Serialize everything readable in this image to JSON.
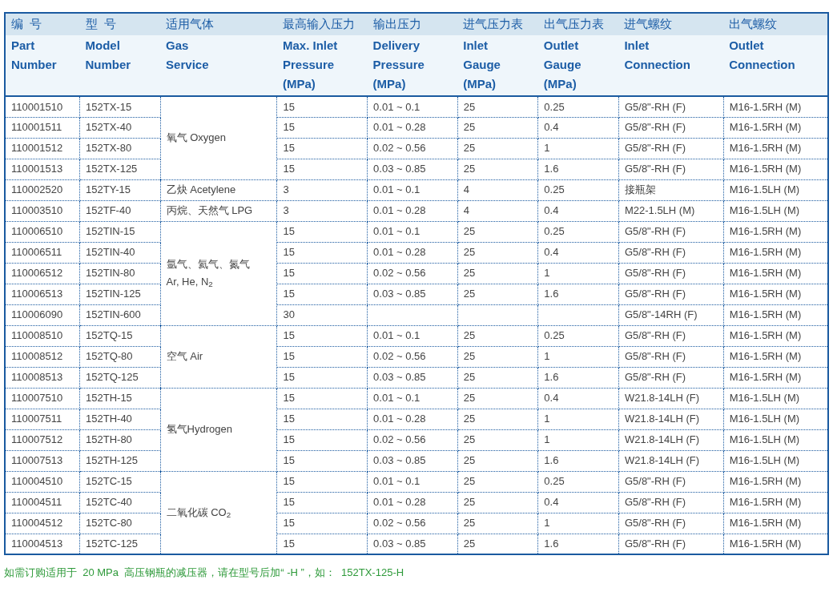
{
  "table": {
    "columns": [
      {
        "zh": "编  号",
        "en": [
          "Part",
          "Number"
        ]
      },
      {
        "zh": "型  号",
        "en": [
          "Model",
          "Number"
        ]
      },
      {
        "zh": "适用气体",
        "en": [
          "Gas",
          "Service"
        ]
      },
      {
        "zh": "最高输入压力",
        "en": [
          "Max. Inlet",
          "Pressure",
          "(MPa)"
        ]
      },
      {
        "zh": "输出压力",
        "en": [
          "Delivery",
          "Pressure",
          "(MPa)"
        ]
      },
      {
        "zh": "进气压力表",
        "en": [
          "Inlet",
          "Gauge",
          "(MPa)"
        ]
      },
      {
        "zh": "出气压力表",
        "en": [
          "Outlet",
          "Gauge",
          "(MPa)"
        ]
      },
      {
        "zh": "进气螺纹",
        "en": [
          "Inlet",
          "Connection"
        ]
      },
      {
        "zh": "出气螺纹",
        "en": [
          "Outlet",
          "Connection"
        ]
      }
    ],
    "groups": [
      {
        "gas": [
          "氧气 Oxygen"
        ],
        "rows": [
          [
            "110001510",
            "152TX-15",
            "15",
            "0.01 ~ 0.1",
            "25",
            "0.25",
            "G5/8\"-RH (F)",
            "M16-1.5RH (M)"
          ],
          [
            "110001511",
            "152TX-40",
            "15",
            "0.01 ~ 0.28",
            "25",
            "0.4",
            "G5/8\"-RH (F)",
            "M16-1.5RH (M)"
          ],
          [
            "110001512",
            "152TX-80",
            "15",
            "0.02 ~ 0.56",
            "25",
            "1",
            "G5/8\"-RH (F)",
            "M16-1.5RH (M)"
          ],
          [
            "110001513",
            "152TX-125",
            "15",
            "0.03 ~ 0.85",
            "25",
            "1.6",
            "G5/8\"-RH (F)",
            "M16-1.5RH (M)"
          ]
        ]
      },
      {
        "gas": [
          "乙炔 Acetylene"
        ],
        "rows": [
          [
            "110002520",
            "152TY-15",
            "3",
            "0.01 ~ 0.1",
            "4",
            "0.25",
            "接瓶架",
            "M16-1.5LH (M)"
          ]
        ]
      },
      {
        "gas": [
          "丙烷、天然气 LPG"
        ],
        "rows": [
          [
            "110003510",
            "152TF-40",
            "3",
            "0.01 ~ 0.28",
            "4",
            "0.4",
            "M22-1.5LH (M)",
            "M16-1.5LH (M)"
          ]
        ]
      },
      {
        "gas": [
          "氩气、氦气、氮气",
          "Ar, He, N$_{2}$"
        ],
        "rows": [
          [
            "110006510",
            "152TIN-15",
            "15",
            "0.01 ~ 0.1",
            "25",
            "0.25",
            "G5/8\"-RH (F)",
            "M16-1.5RH (M)"
          ],
          [
            "110006511",
            "152TIN-40",
            "15",
            "0.01 ~ 0.28",
            "25",
            "0.4",
            "G5/8\"-RH (F)",
            "M16-1.5RH (M)"
          ],
          [
            "110006512",
            "152TIN-80",
            "15",
            "0.02 ~ 0.56",
            "25",
            "1",
            "G5/8\"-RH (F)",
            "M16-1.5RH (M)"
          ],
          [
            "110006513",
            "152TIN-125",
            "15",
            "0.03 ~ 0.85",
            "25",
            "1.6",
            "G5/8\"-RH (F)",
            "M16-1.5RH (M)"
          ],
          [
            "110006090",
            "152TIN-600",
            "30",
            null,
            null,
            null,
            "G5/8\"-14RH (F)",
            "M16-1.5RH (M)"
          ]
        ]
      },
      {
        "gas": [
          "空气 Air"
        ],
        "rows": [
          [
            "110008510",
            "152TQ-15",
            "15",
            "0.01 ~ 0.1",
            "25",
            "0.25",
            "G5/8\"-RH (F)",
            "M16-1.5RH (M)"
          ],
          [
            "110008512",
            "152TQ-80",
            "15",
            "0.02 ~ 0.56",
            "25",
            "1",
            "G5/8\"-RH (F)",
            "M16-1.5RH (M)"
          ],
          [
            "110008513",
            "152TQ-125",
            "15",
            "0.03 ~ 0.85",
            "25",
            "1.6",
            "G5/8\"-RH (F)",
            "M16-1.5RH (M)"
          ]
        ]
      },
      {
        "gas": [
          "氢气Hydrogen"
        ],
        "rows": [
          [
            "110007510",
            "152TH-15",
            "15",
            "0.01 ~ 0.1",
            "25",
            "0.4",
            "W21.8-14LH (F)",
            "M16-1.5LH (M)"
          ],
          [
            "110007511",
            "152TH-40",
            "15",
            "0.01 ~ 0.28",
            "25",
            "1",
            "W21.8-14LH (F)",
            "M16-1.5LH (M)"
          ],
          [
            "110007512",
            "152TH-80",
            "15",
            "0.02 ~ 0.56",
            "25",
            "1",
            "W21.8-14LH (F)",
            "M16-1.5LH (M)"
          ],
          [
            "110007513",
            "152TH-125",
            "15",
            "0.03 ~ 0.85",
            "25",
            "1.6",
            "W21.8-14LH (F)",
            "M16-1.5LH (M)"
          ]
        ]
      },
      {
        "gas": [
          "二氧化碳 CO$_{2}$"
        ],
        "rows": [
          [
            "110004510",
            "152TC-15",
            "15",
            "0.01 ~ 0.1",
            "25",
            "0.25",
            "G5/8\"-RH (F)",
            "M16-1.5RH (M)"
          ],
          [
            "110004511",
            "152TC-40",
            "15",
            "0.01 ~ 0.28",
            "25",
            "0.4",
            "G5/8\"-RH (F)",
            "M16-1.5RH (M)"
          ],
          [
            "110004512",
            "152TC-80",
            "15",
            "0.02 ~ 0.56",
            "25",
            "1",
            "G5/8\"-RH (F)",
            "M16-1.5RH (M)"
          ],
          [
            "110004513",
            "152TC-125",
            "15",
            "0.03 ~ 0.85",
            "25",
            "1.6",
            "G5/8\"-RH (F)",
            "M16-1.5RH (M)"
          ]
        ]
      }
    ]
  },
  "footnote": "如需订购适用于  20 MPa  高压钢瓶的减压器，请在型号后加“ -H ”，如：  152TX-125-H"
}
